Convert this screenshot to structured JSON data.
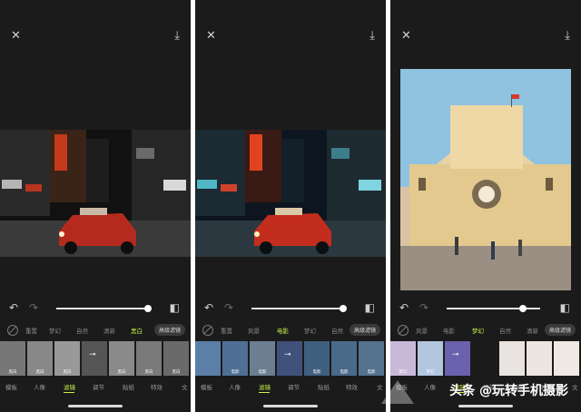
{
  "panels": [
    {
      "categories": [
        "重置",
        "梦幻",
        "自然",
        "清新",
        "黑白"
      ],
      "active_category": "黑白",
      "advanced": "高级滤镜",
      "thumbnails": [
        "黑白",
        "黑白",
        "黑白",
        "",
        "黑白",
        "黑白",
        "黑白"
      ],
      "tabs": [
        "模板",
        "人像",
        "滤镜",
        "调节",
        "贴纸",
        "特效",
        "文"
      ],
      "active_tab": "滤镜",
      "slider_level": 0.98
    },
    {
      "categories": [
        "重置",
        "风景",
        "电影",
        "梦幻",
        "自然"
      ],
      "active_category": "电影",
      "advanced": "高级滤镜",
      "thumbnails": [
        "",
        "电影",
        "电影",
        "",
        "电影",
        "电影",
        "电影"
      ],
      "tabs": [
        "模板",
        "人像",
        "滤镜",
        "调节",
        "贴纸",
        "特效",
        "文"
      ],
      "active_tab": "滤镜",
      "slider_level": 0.98
    },
    {
      "categories": [
        "风景",
        "电影",
        "梦幻",
        "自然",
        "清新"
      ],
      "active_category": "梦幻",
      "advanced": "高级滤镜",
      "thumbnails": [
        "梦幻",
        "梦幻",
        "",
        "",
        "",
        ""
      ],
      "tabs": [
        "模板",
        "人像",
        "滤镜",
        "调节",
        "贴纸",
        "特效",
        "文"
      ],
      "active_tab": "滤镜",
      "slider_level": 0.8
    }
  ],
  "watermark": "头条 @玩转手机摄影",
  "colors": {
    "accent": "#c9f24a",
    "panel_bg": "#1b1b1b"
  },
  "icons": {
    "close": "close-icon",
    "download": "download-icon",
    "undo": "undo-icon",
    "redo": "redo-icon",
    "compare": "compare-icon"
  }
}
